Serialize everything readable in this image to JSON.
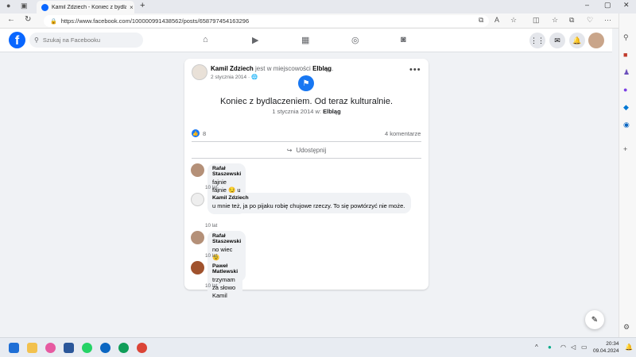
{
  "browser": {
    "tab_title": "Kamil Zdziech - Koniec z bydlac",
    "tab_close": "×",
    "new_tab": "+",
    "url": "https://www.facebook.com/100000991438562/posts/658797454163296",
    "back_icon": "arrow-left",
    "refresh_icon": "refresh",
    "minimize": "–",
    "maximize": "▢",
    "close": "✕"
  },
  "facebook": {
    "search_placeholder": "Szukaj na Facebooku",
    "logo_letter": "f"
  },
  "post": {
    "author": "Kamil Zdziech",
    "location_prefix": "jest w miejscowości",
    "location": "Elbląg",
    "location_suffix": ".",
    "date": "2 stycznia 2014",
    "date_sep": "·",
    "event_title": "Koniec z bydlaczeniem. Od teraz kulturalnie.",
    "event_date": "1 stycznia 2014 w:",
    "event_place": "Elbląg",
    "reaction_count": "8",
    "comments_count": "4 komentarze",
    "share_label": "Udostępnij",
    "more_label": "•••"
  },
  "comments": [
    {
      "author": "Rafał Staszewski",
      "text": "fajnie fajnie 😏 u mnie juz rygor xD",
      "time": "10 lat"
    },
    {
      "author": "Kamil Zdziech",
      "text": "u mnie też, ja po pijaku robię chujowe rzeczy. To się powtórzyć nie może.",
      "time": "10 lat"
    },
    {
      "author": "Rafał Staszewski",
      "text": "no wiec 😉 kulturka 😀",
      "time": "10 lat"
    },
    {
      "author": "Paweł Matlewski",
      "text": "trzymam za słowo Kamil",
      "time": "10 lat"
    }
  ],
  "taskbar": {
    "time": "20:34",
    "date": "09.04.2024"
  },
  "colors": {
    "facebook_blue": "#0866ff",
    "background": "#f0f2f5"
  }
}
